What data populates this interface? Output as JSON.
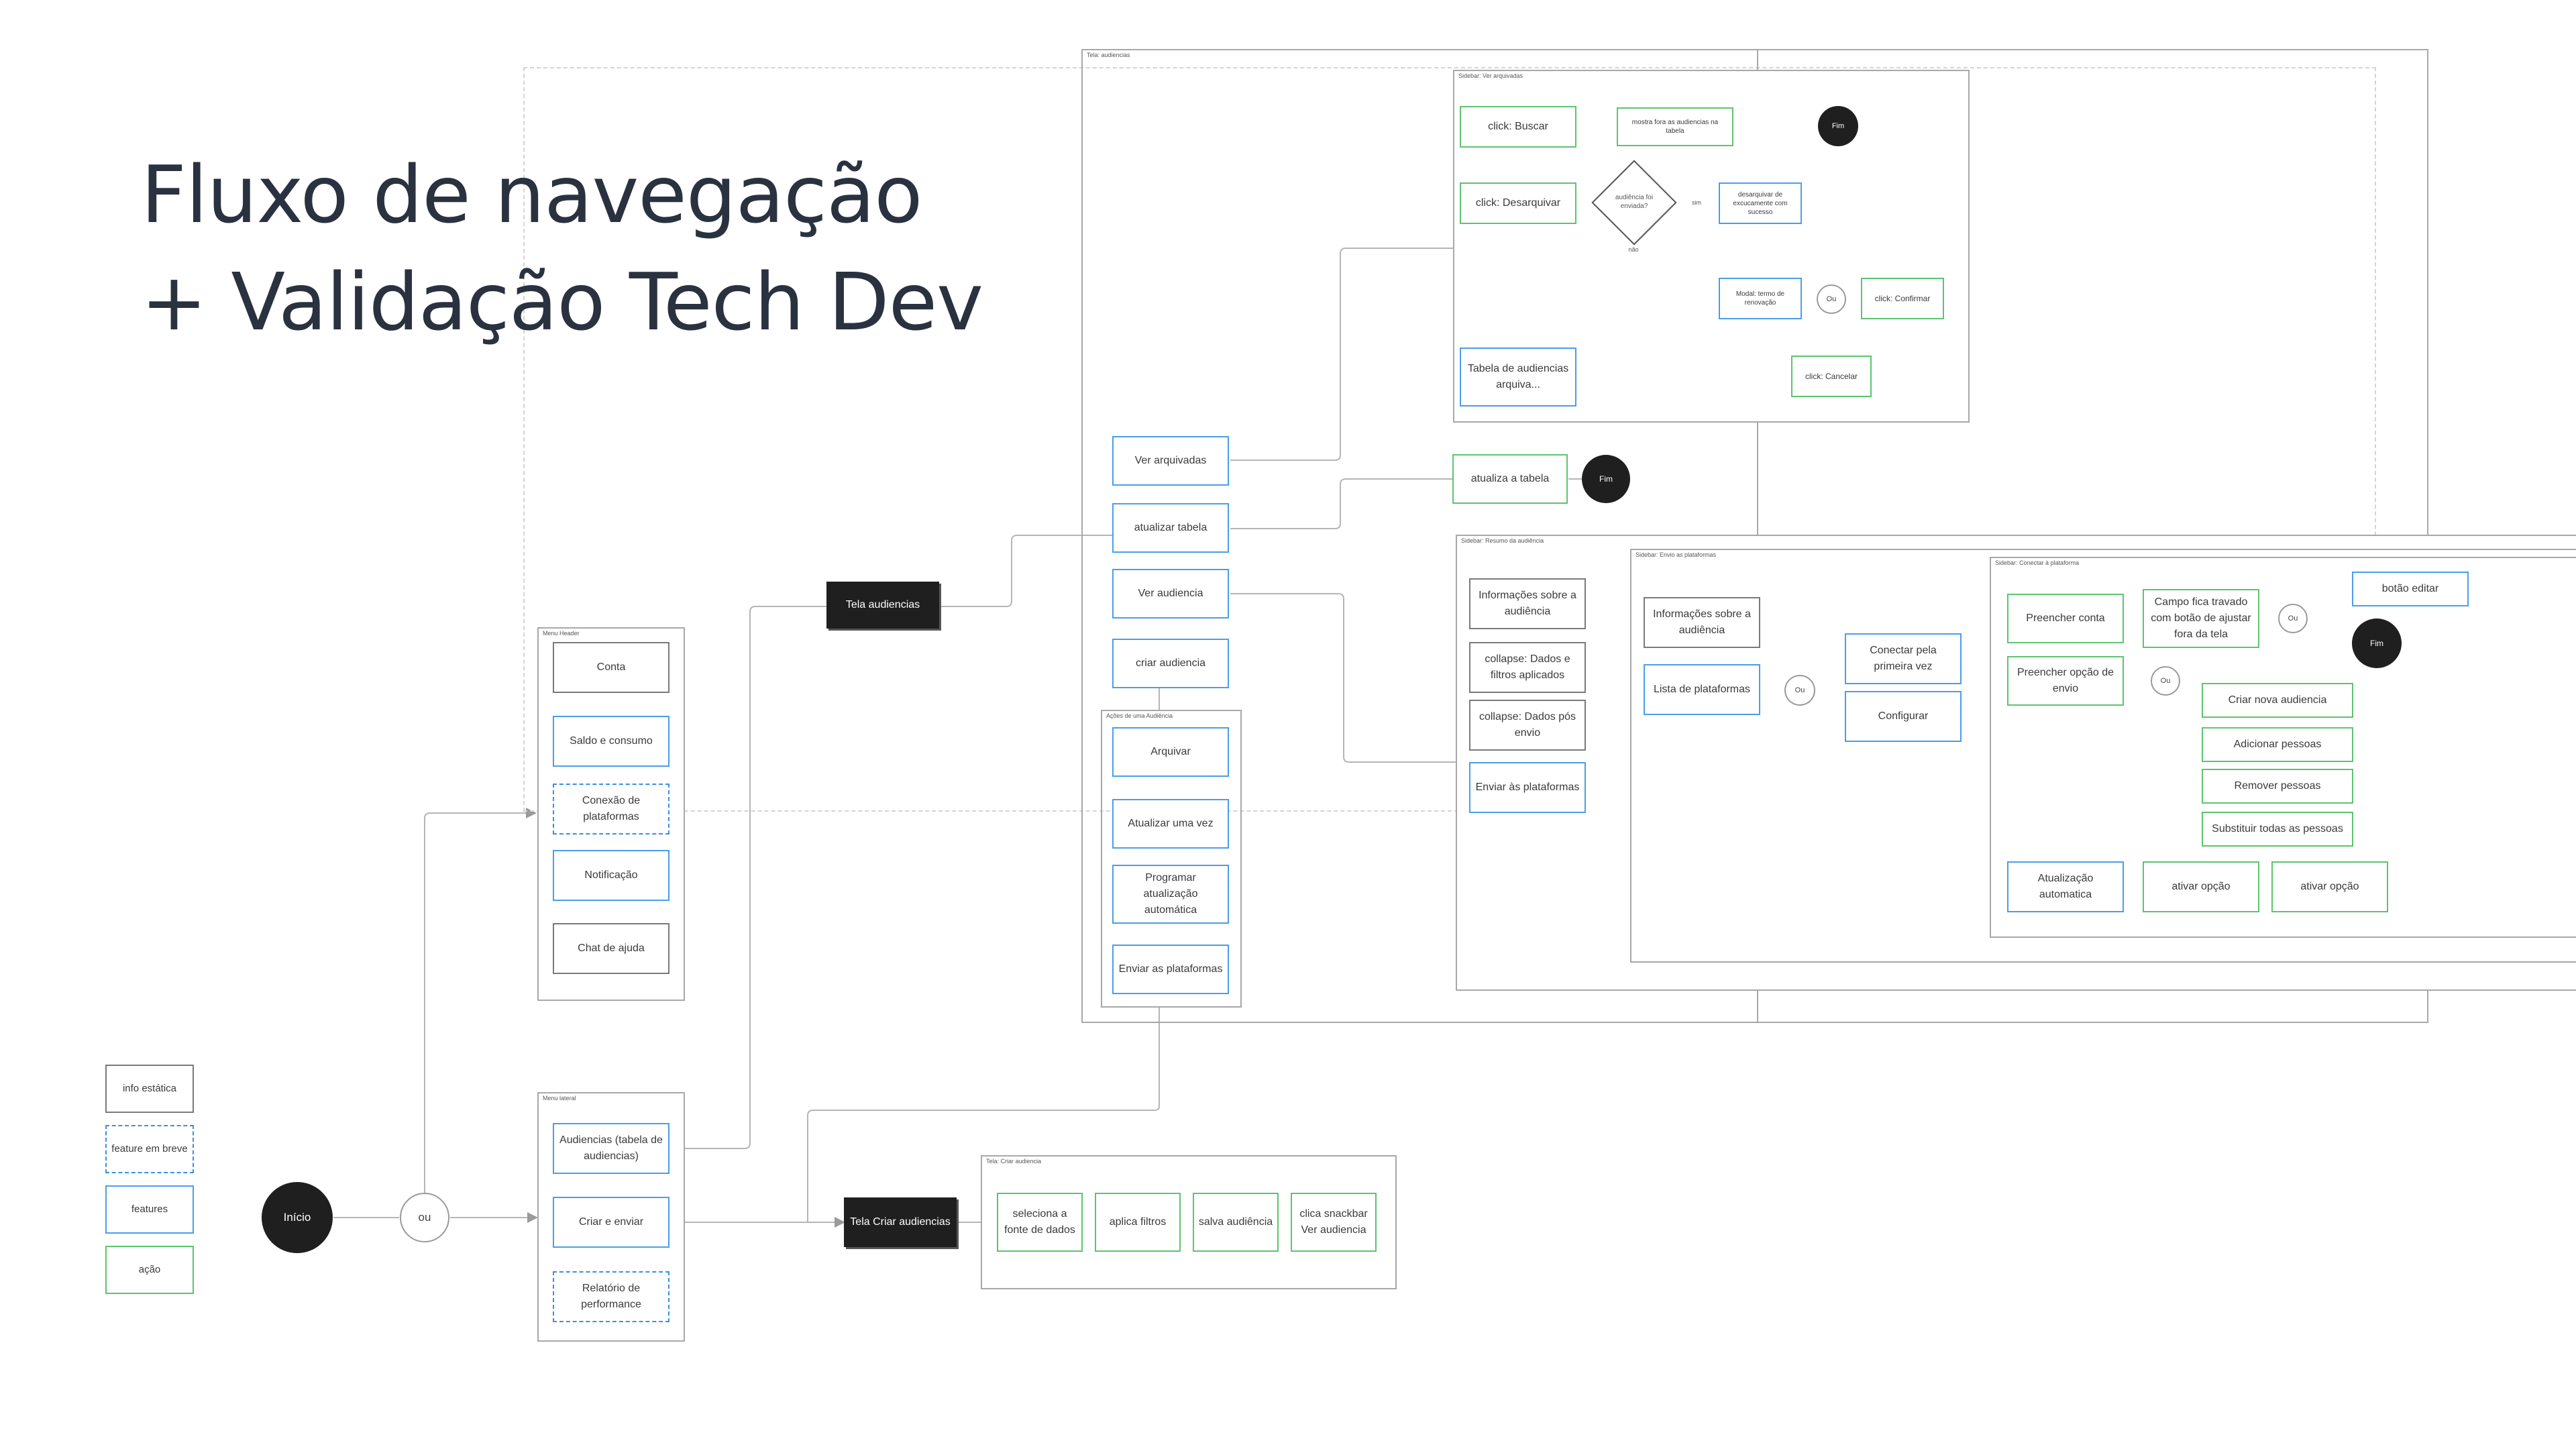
{
  "title": {
    "line1": "Fluxo de navegação",
    "line2": "+ Validação Tech Dev"
  },
  "legend": {
    "info": "info estática",
    "soon": "feature em breve",
    "feature": "features",
    "action": "ação"
  },
  "start": {
    "inicio": "Início",
    "ou": "ou"
  },
  "menu_header": {
    "label": "Menu Header",
    "items": [
      "Conta",
      "Saldo e consumo",
      "Conexão de plataformas",
      "Notificação",
      "Chat de ajuda"
    ]
  },
  "menu_lateral": {
    "label": "Menu lateral",
    "items": [
      "Audiencias (tabela de audiencias)",
      "Criar e enviar",
      "Relatório de performance"
    ]
  },
  "tela_audiencias": {
    "label": "Tela audiencias",
    "frame_label": "Tela: audiencias",
    "items": [
      "Ver arquivadas",
      "atualizar tabela",
      "Ver audiencia",
      "criar audiencia"
    ]
  },
  "acoes": {
    "frame_label": "Ações de uma Audiência",
    "items": [
      "Arquivar",
      "Atualizar uma vez",
      "Programar atualização automática",
      "Enviar as plataformas"
    ]
  },
  "sidebar_arquivadas": {
    "frame_label": "Sidebar: Ver arquivadas",
    "buscar": "click: Buscar",
    "mostra_fora": "mostra fora as audiencias na tabela",
    "fim": "Fim",
    "desarquivar": "click: Desarquivar",
    "decision": "audiência foi enviada?",
    "desarquivar_ok": "desarquivar de excucamente com sucesso",
    "sim": "sim",
    "nao": "não",
    "modal": "Modal: termo de renovação",
    "ou": "Ou",
    "confirmar": "click: Confirmar",
    "cancelar": "click: Cancelar",
    "tabela": "Tabela de audiencias arquiva..."
  },
  "atualizar": {
    "result": "atualiza a tabela",
    "fim": "Fim"
  },
  "sidebar_resumo": {
    "frame_label": "Sidebar: Resumo da audiência",
    "items": [
      "Informações sobre a audiência",
      "collapse: Dados e filtros aplicados",
      "collapse: Dados pós envio",
      "Enviar às plataformas"
    ]
  },
  "sidebar_envio": {
    "frame_label": "Sidebar: Envio as plataformas",
    "info": "Informações sobre a audiência",
    "lista": "Lista de plataformas",
    "ou": "Ou",
    "conectar": "Conectar pela primeira vez",
    "configurar": "Configurar"
  },
  "sidebar_conectar": {
    "frame_label": "Sidebar: Conectar à plataforma",
    "preencher_conta": "Preencher conta",
    "campo": "Campo fica travado com botão de ajustar fora da tela",
    "ou1": "Ou",
    "botao_editar": "botão editar",
    "fim": "Fim",
    "preencher_envio": "Preencher opção de envio",
    "ou2": "Ou",
    "opcoes": [
      "Criar nova audiencia",
      "Adicionar pessoas",
      "Remover pessoas",
      "Substituir todas as pessoas"
    ],
    "atualizacao": "Atualização automatica",
    "ativar1": "ativar opção",
    "ativar2": "ativar opção"
  },
  "tela_criar": {
    "label": "Tela Criar audiencias",
    "frame_label": "Tela: Criar audiencia",
    "steps": [
      "seleciona a fonte de dados",
      "aplica filtros",
      "salva audiência",
      "clica snackbar Ver audiencia"
    ]
  },
  "colors": {
    "info": "#7a7a7a",
    "feature": "#4a9ee8",
    "action": "#5cc46f",
    "dark": "#1f1f1f"
  }
}
